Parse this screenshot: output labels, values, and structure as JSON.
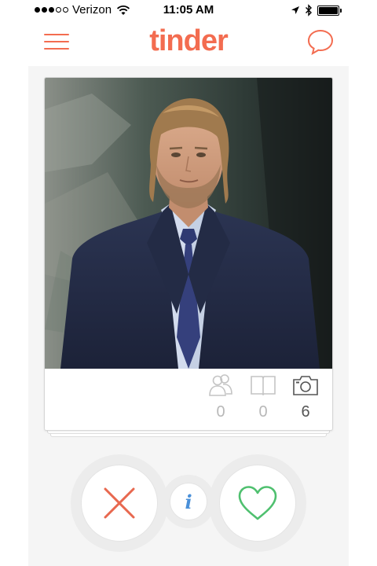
{
  "status_bar": {
    "carrier": "Verizon",
    "time": "11:05 AM",
    "signal_bars_filled": 3,
    "signal_bars_total": 5
  },
  "nav": {
    "logo": "tinder",
    "menu_icon": "hamburger-menu-icon",
    "chat_icon": "chat-bubble-icon"
  },
  "profile": {
    "stats": {
      "common_friends": "0",
      "common_interests": "0",
      "photos": "6"
    }
  },
  "actions": {
    "nope_icon": "close-x-icon",
    "info_label": "i",
    "like_icon": "heart-icon"
  },
  "colors": {
    "brand": "#f36c50",
    "nope": "#e8684f",
    "like": "#4fc06f",
    "info": "#4a90d9"
  }
}
